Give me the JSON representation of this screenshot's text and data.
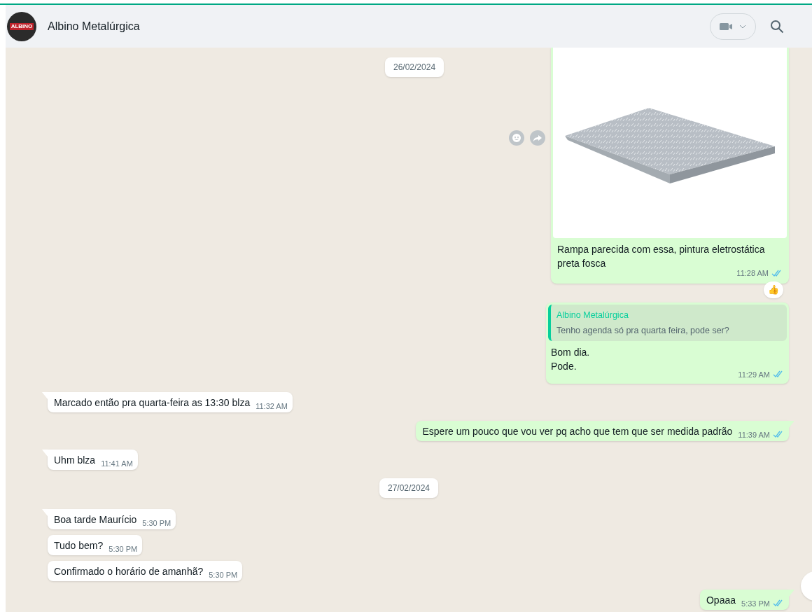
{
  "header": {
    "title": "Albino Metalúrgica",
    "avatar_text": "ALBINO"
  },
  "floating_date": "26/02/2024",
  "messages": [
    {
      "kind": "image",
      "outgoing": true,
      "caption_lines": [
        "Rampa parecida com essa, pintura eletrostática",
        "preta fosca"
      ],
      "time": "11:28 AM",
      "read": true,
      "reaction": "👍",
      "hover_actions": true
    },
    {
      "kind": "reply",
      "outgoing": true,
      "quote_author": "Albino Metalúrgica",
      "quote_text": "Tenho agenda só pra quarta feira, pode ser?",
      "lines": [
        "Bom dia.",
        "Pode."
      ],
      "time": "11:29 AM",
      "read": true
    },
    {
      "kind": "text",
      "outgoing": false,
      "tail": true,
      "text": "Marcado então pra quarta-feira as 13:30 blza",
      "time": "11:32 AM"
    },
    {
      "kind": "text",
      "outgoing": true,
      "tail": true,
      "text": "Espere um pouco que vou ver pq acho que tem que ser medida padrão",
      "time": "11:39 AM",
      "read": true
    },
    {
      "kind": "text",
      "outgoing": false,
      "tail": true,
      "text": "Uhm blza",
      "time": "11:41 AM"
    },
    {
      "kind": "date",
      "text": "27/02/2024"
    },
    {
      "kind": "text",
      "outgoing": false,
      "tail": true,
      "text": "Boa tarde Maurício",
      "time": "5:30 PM"
    },
    {
      "kind": "text",
      "outgoing": false,
      "tail": false,
      "text": "Tudo bem?",
      "time": "5:30 PM"
    },
    {
      "kind": "text",
      "outgoing": false,
      "tail": false,
      "text": "Confirmado o horário de amanhã?",
      "time": "5:30 PM"
    },
    {
      "kind": "text",
      "outgoing": true,
      "tail": true,
      "text": "Opaaa",
      "time": "5:33 PM",
      "read": true
    }
  ]
}
